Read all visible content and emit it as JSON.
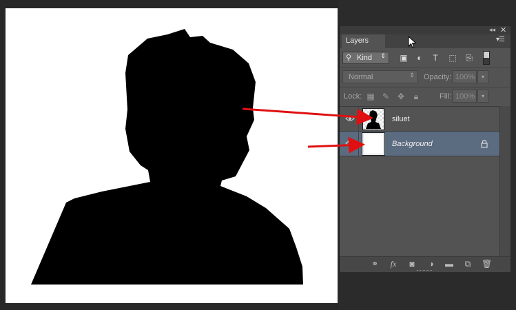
{
  "panel": {
    "tab_label": "Layers",
    "panel_menu_icon": "panel-menu-icon",
    "collapse_icon": "double-chevron-icon",
    "close_icon": "close-icon"
  },
  "filter": {
    "kind_label": "Kind",
    "icons": [
      "image-filter-icon",
      "adjustment-filter-icon",
      "type-filter-icon",
      "shape-filter-icon",
      "smart-object-filter-icon"
    ]
  },
  "blend": {
    "mode": "Normal",
    "opacity_label": "Opacity:",
    "opacity_value": "100%"
  },
  "lock": {
    "label": "Lock:",
    "fill_label": "Fill:",
    "fill_value": "100%"
  },
  "layers": [
    {
      "name": "siluet",
      "visible": true,
      "selected": false,
      "locked": false
    },
    {
      "name": "Background",
      "visible": true,
      "selected": true,
      "locked": true
    }
  ],
  "footer": {
    "icons": [
      "link-layers-icon",
      "fx-icon",
      "mask-icon",
      "adjustment-layer-icon",
      "group-folder-icon",
      "new-layer-icon",
      "trash-icon"
    ]
  },
  "colors": {
    "selected_row": "#5b6b80",
    "annotation_arrow": "#e01010",
    "panel_bg": "#535353"
  }
}
